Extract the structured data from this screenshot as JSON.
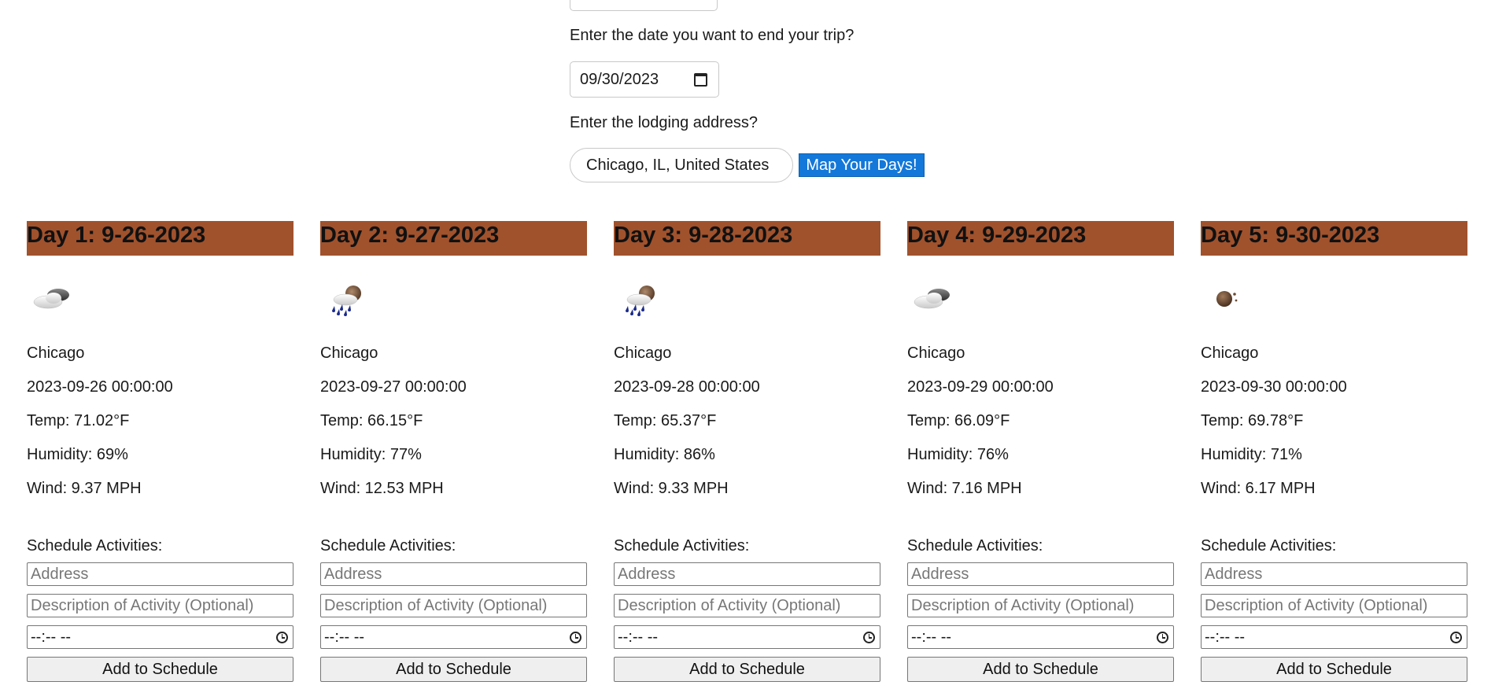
{
  "form": {
    "end_date_label": "Enter the date you want to end your trip?",
    "end_date_value": "09/30/2023",
    "lodging_label": "Enter the lodging address?",
    "lodging_value": "Chicago, IL, United States",
    "map_button_label": "Map Your Days!"
  },
  "days": [
    {
      "title": "Day 1: 9-26-2023",
      "icon": "cloud-icon",
      "city": "Chicago",
      "datetime": "2023-09-26 00:00:00",
      "temp": "Temp: 71.02°F",
      "humidity": "Humidity: 69%",
      "wind": "Wind: 9.37 MPH"
    },
    {
      "title": "Day 2: 9-27-2023",
      "icon": "rain-icon",
      "city": "Chicago",
      "datetime": "2023-09-27 00:00:00",
      "temp": "Temp: 66.15°F",
      "humidity": "Humidity: 77%",
      "wind": "Wind: 12.53 MPH"
    },
    {
      "title": "Day 3: 9-28-2023",
      "icon": "rain-icon",
      "city": "Chicago",
      "datetime": "2023-09-28 00:00:00",
      "temp": "Temp: 65.37°F",
      "humidity": "Humidity: 86%",
      "wind": "Wind: 9.33 MPH"
    },
    {
      "title": "Day 4: 9-29-2023",
      "icon": "cloud-icon",
      "city": "Chicago",
      "datetime": "2023-09-29 00:00:00",
      "temp": "Temp: 66.09°F",
      "humidity": "Humidity: 76%",
      "wind": "Wind: 7.16 MPH"
    },
    {
      "title": "Day 5: 9-30-2023",
      "icon": "moon-icon",
      "city": "Chicago",
      "datetime": "2023-09-30 00:00:00",
      "temp": "Temp: 69.78°F",
      "humidity": "Humidity: 71%",
      "wind": "Wind: 6.17 MPH"
    }
  ],
  "schedule": {
    "heading": "Schedule Activities:",
    "address_placeholder": "Address",
    "description_placeholder": "Description of Activity (Optional)",
    "time_value": "--:-- --",
    "add_button_label": "Add to Schedule"
  },
  "colors": {
    "day_header_bg": "#a0522d",
    "map_button_bg": "#1378d9"
  }
}
